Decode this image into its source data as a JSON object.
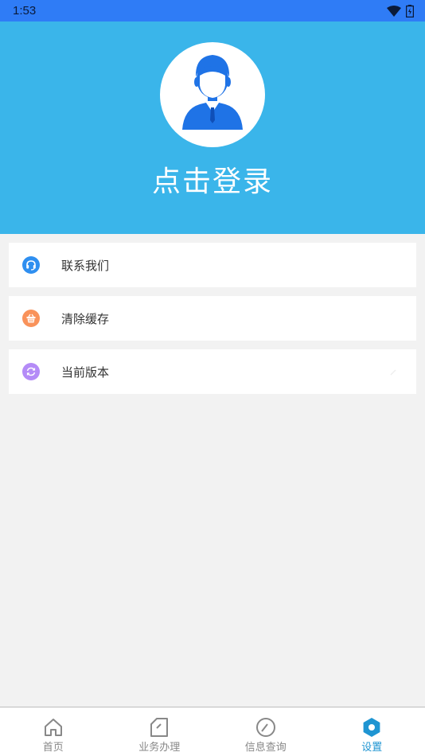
{
  "status_bar": {
    "time": "1:53"
  },
  "header": {
    "login_text": "点击登录"
  },
  "menu": {
    "items": [
      {
        "label": "联系我们",
        "icon": "headset-icon",
        "color": "#2f8ff0"
      },
      {
        "label": "清除缓存",
        "icon": "basket-icon",
        "color": "#f9925a"
      },
      {
        "label": "当前版本",
        "icon": "refresh-icon",
        "color": "#b48bf7"
      }
    ]
  },
  "tabbar": {
    "tabs": [
      {
        "label": "首页",
        "icon": "home-icon",
        "active": false
      },
      {
        "label": "业务办理",
        "icon": "document-icon",
        "active": false
      },
      {
        "label": "信息查询",
        "icon": "gauge-icon",
        "active": false
      },
      {
        "label": "设置",
        "icon": "settings-icon",
        "active": true
      }
    ]
  },
  "colors": {
    "status_bar": "#2f7cf6",
    "header": "#3ab5ea",
    "active_tab": "#1f95d2",
    "avatar_figure": "#1f73e6"
  }
}
